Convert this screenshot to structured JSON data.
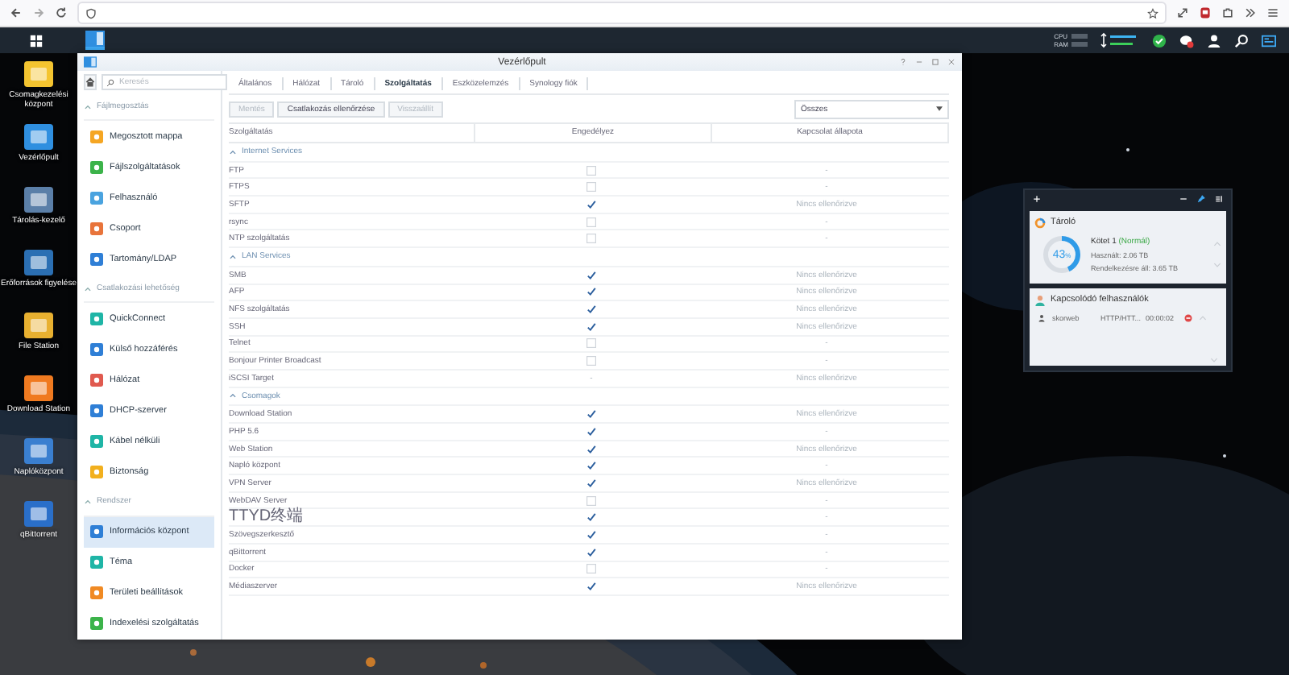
{
  "taskbar": {
    "cpu_label": "CPU",
    "ram_label": "RAM"
  },
  "desktop_icons": [
    {
      "label": "Csomagkezelési központ"
    },
    {
      "label": "Vezérlőpult"
    },
    {
      "label": "Tárolás-kezelő"
    },
    {
      "label": "Erőforrások figyelése"
    },
    {
      "label": "File Station"
    },
    {
      "label": "Download Station"
    },
    {
      "label": "Naplóközpont"
    },
    {
      "label": "qBittorrent"
    }
  ],
  "window": {
    "title": "Vezérlőpult"
  },
  "sidebar": {
    "search_placeholder": "Keresés",
    "sections": [
      {
        "title": "Fájlmegosztás",
        "expanded": true,
        "items": [
          {
            "label": "Megosztott mappa",
            "selected": false
          },
          {
            "label": "Fájlszolgáltatások",
            "selected": false
          },
          {
            "label": "Felhasználó",
            "selected": false
          },
          {
            "label": "Csoport",
            "selected": false
          },
          {
            "label": "Tartomány/LDAP",
            "selected": false
          }
        ]
      },
      {
        "title": "Csatlakozási lehetőség",
        "expanded": true,
        "items": [
          {
            "label": "QuickConnect",
            "selected": false
          },
          {
            "label": "Külső hozzáférés",
            "selected": false
          },
          {
            "label": "Hálózat",
            "selected": false
          },
          {
            "label": "DHCP-szerver",
            "selected": false
          },
          {
            "label": "Kábel nélküli",
            "selected": false
          },
          {
            "label": "Biztonság",
            "selected": false
          }
        ]
      },
      {
        "title": "Rendszer",
        "expanded": true,
        "items": [
          {
            "label": "Információs központ",
            "selected": true
          },
          {
            "label": "Téma",
            "selected": false
          },
          {
            "label": "Területi beállítások",
            "selected": false
          },
          {
            "label": "Indexelési szolgáltatás",
            "selected": false
          }
        ]
      }
    ]
  },
  "tabs": [
    {
      "label": "Általános",
      "selected": false
    },
    {
      "label": "Hálózat",
      "selected": false
    },
    {
      "label": "Tároló",
      "selected": false
    },
    {
      "label": "Szolgáltatás",
      "selected": true
    },
    {
      "label": "Eszközelemzés",
      "selected": false
    },
    {
      "label": "Synology fiók",
      "selected": false
    }
  ],
  "toolbar": {
    "buttons": [
      {
        "label": "Mentés",
        "disabled": true
      },
      {
        "label": "Csatlakozás ellenőrzése",
        "disabled": false
      },
      {
        "label": "Visszaállít",
        "disabled": true
      }
    ],
    "filter": "Összes"
  },
  "table": {
    "columns": [
      "Szolgáltatás",
      "Engedélyez",
      "Kapcsolat állapota"
    ],
    "groups": [
      {
        "title": "Internet Services",
        "expanded": true,
        "rows": [
          {
            "name": "FTP",
            "kind": "checkbox",
            "checked": false,
            "status": "-"
          },
          {
            "name": "FTPS",
            "kind": "checkbox",
            "checked": false,
            "status": "-"
          },
          {
            "name": "SFTP",
            "kind": "checkbox",
            "checked": true,
            "status": "Nincs ellenőrizve"
          },
          {
            "name": "rsync",
            "kind": "checkbox",
            "checked": false,
            "status": "-"
          },
          {
            "name": "NTP szolgáltatás",
            "kind": "checkbox",
            "checked": false,
            "status": "-"
          }
        ]
      },
      {
        "title": "LAN Services",
        "expanded": true,
        "rows": [
          {
            "name": "SMB",
            "kind": "checkbox",
            "checked": true,
            "status": "Nincs ellenőrizve"
          },
          {
            "name": "AFP",
            "kind": "checkbox",
            "checked": true,
            "status": "Nincs ellenőrizve"
          },
          {
            "name": "NFS szolgáltatás",
            "kind": "checkbox",
            "checked": true,
            "status": "Nincs ellenőrizve"
          },
          {
            "name": "SSH",
            "kind": "checkbox",
            "checked": true,
            "status": "Nincs ellenőrizve"
          },
          {
            "name": "Telnet",
            "kind": "checkbox",
            "checked": false,
            "status": "-"
          },
          {
            "name": "Bonjour Printer Broadcast",
            "kind": "checkbox",
            "checked": false,
            "status": "-"
          },
          {
            "name": "iSCSI Target",
            "kind": "text",
            "enable": "-",
            "status": "Nincs ellenőrizve"
          }
        ]
      },
      {
        "title": "Csomagok",
        "expanded": true,
        "rows": [
          {
            "name": "Download Station",
            "kind": "checkbox",
            "checked": true,
            "status": "Nincs ellenőrizve"
          },
          {
            "name": "PHP 5.6",
            "kind": "checkbox",
            "checked": true,
            "status": "-"
          },
          {
            "name": "Web Station",
            "kind": "checkbox",
            "checked": true,
            "status": "Nincs ellenőrizve"
          },
          {
            "name": "Napló központ",
            "kind": "checkbox",
            "checked": true,
            "status": "-"
          },
          {
            "name": "VPN Server",
            "kind": "checkbox",
            "checked": true,
            "status": "Nincs ellenőrizve"
          },
          {
            "name": "WebDAV Server",
            "kind": "checkbox",
            "checked": false,
            "status": "-"
          },
          {
            "name": "TTYD终端",
            "kind": "checkbox",
            "checked": true,
            "status": "-"
          },
          {
            "name": "Szövegszerkesztő",
            "kind": "checkbox",
            "checked": true,
            "status": "-"
          },
          {
            "name": "qBittorrent",
            "kind": "checkbox",
            "checked": true,
            "status": "-"
          },
          {
            "name": "Docker",
            "kind": "checkbox",
            "checked": false,
            "status": "-"
          },
          {
            "name": "Médiaszerver",
            "kind": "checkbox",
            "checked": true,
            "status": "Nincs ellenőrizve"
          }
        ]
      }
    ]
  },
  "widget": {
    "storage": {
      "title": "Tároló",
      "percent": "43",
      "percent_unit": "%",
      "level": 0.43,
      "volume": "Kötet 1",
      "status": "(Normál)",
      "used": "Használt: 2.06 TB",
      "available": "Rendelkezésre áll: 3.65 TB"
    },
    "users": {
      "title": "Kapcsolódó felhasználók",
      "items": [
        {
          "name": "skorweb",
          "protocol": "HTTP/HTT...",
          "time": "00:00:02"
        }
      ]
    }
  }
}
